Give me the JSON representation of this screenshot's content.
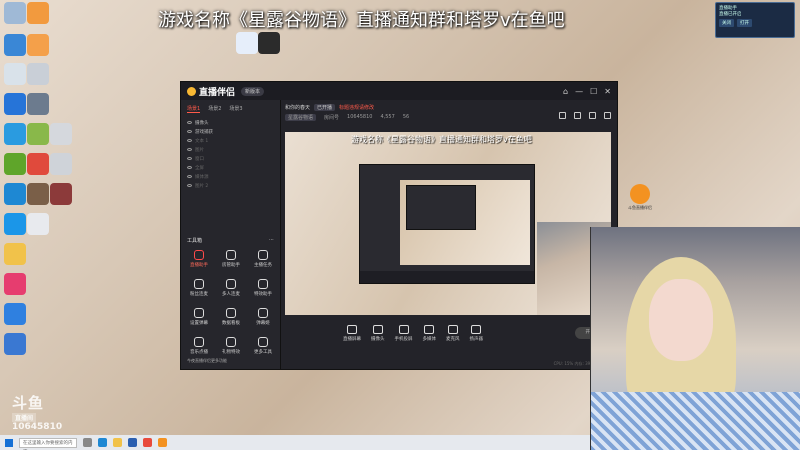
{
  "stream": {
    "announcement": "游戏名称《星露谷物语》直播通知群和塔罗v在鱼吧"
  },
  "notification": {
    "line1": "直播助手",
    "line2": "直播已开启",
    "btn1": "关闭",
    "btn2": "打开"
  },
  "app": {
    "brand": "直播伴侣",
    "version": "新版本",
    "controls": [
      "⌂",
      "—",
      "☐",
      "✕"
    ],
    "sidebar": {
      "tabs": [
        "场景1",
        "场景2",
        "场景3"
      ],
      "sources": [
        {
          "label": "摄像头",
          "dim": false
        },
        {
          "label": "游戏捕获",
          "dim": false
        },
        {
          "label": "文本 1",
          "dim": true
        },
        {
          "label": "图片",
          "dim": true
        },
        {
          "label": "窗口",
          "dim": true
        },
        {
          "label": "全屏",
          "dim": true
        },
        {
          "label": "媒体源",
          "dim": true
        },
        {
          "label": "图片 2",
          "dim": true
        }
      ],
      "tools_title": "工具箱",
      "tools": [
        {
          "label": "直播助手",
          "red": true
        },
        {
          "label": "房管助手",
          "red": false
        },
        {
          "label": "主播任务",
          "red": false
        },
        {
          "label": "粉丝连麦",
          "red": false
        },
        {
          "label": "多人连麦",
          "red": false
        },
        {
          "label": "特效助手",
          "red": false
        },
        {
          "label": "设置弹幕",
          "red": false
        },
        {
          "label": "数据看板",
          "red": false
        },
        {
          "label": "弹幕姬",
          "red": false
        },
        {
          "label": "音乐点播",
          "red": false
        },
        {
          "label": "礼物特效",
          "red": false
        },
        {
          "label": "更多工具",
          "red": false
        }
      ],
      "footer": "今夜直播伴侣更多功能"
    },
    "header": {
      "title": "和你的春天",
      "tag": "已开播",
      "warning": "标题违规请修改",
      "category": "星露谷物语",
      "room_label": "房间号",
      "room_id": "10645810",
      "fans": "4,557",
      "online": "56"
    },
    "preview": {
      "title": "游戏名称《星露谷物语》直播通知群和塔罗v在鱼吧"
    },
    "bottom": [
      {
        "label": "直播屏幕"
      },
      {
        "label": "摄像头"
      },
      {
        "label": "手机投屏"
      },
      {
        "label": "多媒体"
      },
      {
        "label": "麦克风"
      },
      {
        "label": "扬声器"
      }
    ],
    "go_live": "开始",
    "status": "CPU: 15%  内存: 39%  帧率: 60"
  },
  "watermark": {
    "brand": "斗鱼",
    "sub": "直播间",
    "room": "10645810"
  },
  "floating": {
    "label": "斗鱼直播伴侣"
  },
  "taskbar": {
    "search": "在这里输入你要搜索的内容"
  },
  "colors": {
    "accent": "#ff5a4a",
    "app_bg": "#232329",
    "taskbar": "#e6e9ee"
  }
}
